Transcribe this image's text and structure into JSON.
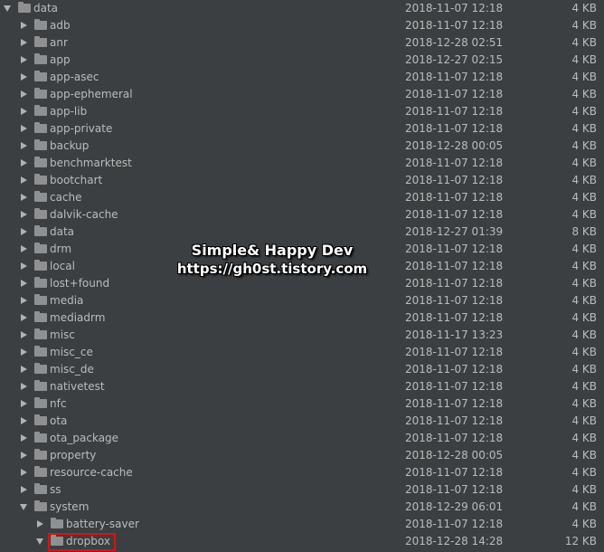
{
  "tree": [
    {
      "name": "data",
      "date": "2018-11-07 12:18",
      "size": "4 KB",
      "depth": 0,
      "expanded": true
    },
    {
      "name": "adb",
      "date": "2018-11-07 12:18",
      "size": "4 KB",
      "depth": 1,
      "expanded": false
    },
    {
      "name": "anr",
      "date": "2018-12-28 02:51",
      "size": "4 KB",
      "depth": 1,
      "expanded": false
    },
    {
      "name": "app",
      "date": "2018-12-27 02:15",
      "size": "4 KB",
      "depth": 1,
      "expanded": false
    },
    {
      "name": "app-asec",
      "date": "2018-11-07 12:18",
      "size": "4 KB",
      "depth": 1,
      "expanded": false
    },
    {
      "name": "app-ephemeral",
      "date": "2018-11-07 12:18",
      "size": "4 KB",
      "depth": 1,
      "expanded": false
    },
    {
      "name": "app-lib",
      "date": "2018-11-07 12:18",
      "size": "4 KB",
      "depth": 1,
      "expanded": false
    },
    {
      "name": "app-private",
      "date": "2018-11-07 12:18",
      "size": "4 KB",
      "depth": 1,
      "expanded": false
    },
    {
      "name": "backup",
      "date": "2018-12-28 00:05",
      "size": "4 KB",
      "depth": 1,
      "expanded": false
    },
    {
      "name": "benchmarktest",
      "date": "2018-11-07 12:18",
      "size": "4 KB",
      "depth": 1,
      "expanded": false
    },
    {
      "name": "bootchart",
      "date": "2018-11-07 12:18",
      "size": "4 KB",
      "depth": 1,
      "expanded": false
    },
    {
      "name": "cache",
      "date": "2018-11-07 12:18",
      "size": "4 KB",
      "depth": 1,
      "expanded": false
    },
    {
      "name": "dalvik-cache",
      "date": "2018-11-07 12:18",
      "size": "4 KB",
      "depth": 1,
      "expanded": false
    },
    {
      "name": "data",
      "date": "2018-12-27 01:39",
      "size": "8 KB",
      "depth": 1,
      "expanded": false
    },
    {
      "name": "drm",
      "date": "2018-11-07 12:18",
      "size": "4 KB",
      "depth": 1,
      "expanded": false
    },
    {
      "name": "local",
      "date": "2018-11-07 12:18",
      "size": "4 KB",
      "depth": 1,
      "expanded": false
    },
    {
      "name": "lost+found",
      "date": "2018-11-07 12:18",
      "size": "4 KB",
      "depth": 1,
      "expanded": false
    },
    {
      "name": "media",
      "date": "2018-11-07 12:18",
      "size": "4 KB",
      "depth": 1,
      "expanded": false
    },
    {
      "name": "mediadrm",
      "date": "2018-11-07 12:18",
      "size": "4 KB",
      "depth": 1,
      "expanded": false
    },
    {
      "name": "misc",
      "date": "2018-11-17 13:23",
      "size": "4 KB",
      "depth": 1,
      "expanded": false
    },
    {
      "name": "misc_ce",
      "date": "2018-11-07 12:18",
      "size": "4 KB",
      "depth": 1,
      "expanded": false
    },
    {
      "name": "misc_de",
      "date": "2018-11-07 12:18",
      "size": "4 KB",
      "depth": 1,
      "expanded": false
    },
    {
      "name": "nativetest",
      "date": "2018-11-07 12:18",
      "size": "4 KB",
      "depth": 1,
      "expanded": false
    },
    {
      "name": "nfc",
      "date": "2018-11-07 12:18",
      "size": "4 KB",
      "depth": 1,
      "expanded": false
    },
    {
      "name": "ota",
      "date": "2018-11-07 12:18",
      "size": "4 KB",
      "depth": 1,
      "expanded": false
    },
    {
      "name": "ota_package",
      "date": "2018-11-07 12:18",
      "size": "4 KB",
      "depth": 1,
      "expanded": false
    },
    {
      "name": "property",
      "date": "2018-12-28 00:05",
      "size": "4 KB",
      "depth": 1,
      "expanded": false
    },
    {
      "name": "resource-cache",
      "date": "2018-11-07 12:18",
      "size": "4 KB",
      "depth": 1,
      "expanded": false
    },
    {
      "name": "ss",
      "date": "2018-11-07 12:18",
      "size": "4 KB",
      "depth": 1,
      "expanded": false
    },
    {
      "name": "system",
      "date": "2018-12-29 06:01",
      "size": "4 KB",
      "depth": 1,
      "expanded": true
    },
    {
      "name": "battery-saver",
      "date": "2018-11-07 12:18",
      "size": "4 KB",
      "depth": 2,
      "expanded": false
    },
    {
      "name": "dropbox",
      "date": "2018-12-28 14:28",
      "size": "12 KB",
      "depth": 2,
      "expanded": true,
      "highlighted": true
    }
  ],
  "watermark": {
    "line1": "Simple& Happy Dev",
    "line2": "https://gh0st.tistory.com"
  },
  "colors": {
    "background": "#3c3f41",
    "text": "#bbbbbb",
    "folder": "#8e9092",
    "highlight": "#e11010"
  },
  "icons": {
    "folder": "folder-icon",
    "collapsed": "chevron-right-icon",
    "expanded": "chevron-down-icon"
  }
}
